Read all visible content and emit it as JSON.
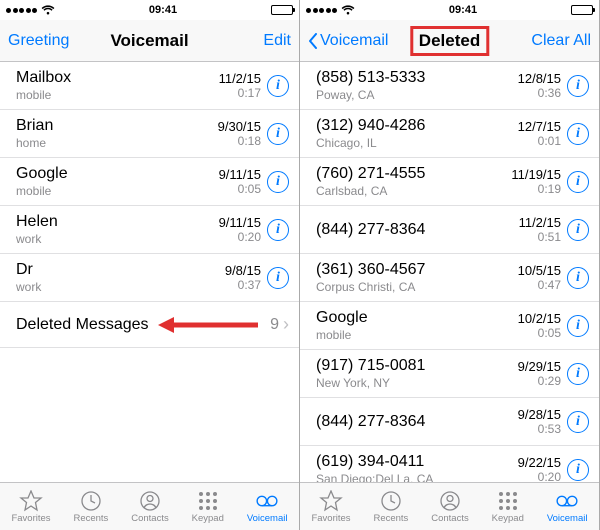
{
  "status": {
    "time": "09:41"
  },
  "left": {
    "nav": {
      "left": "Greeting",
      "title": "Voicemail",
      "right": "Edit"
    },
    "rows": [
      {
        "name": "Mailbox",
        "sub": "mobile",
        "date": "11/2/15",
        "time": "0:17"
      },
      {
        "name": "Brian",
        "sub": "home",
        "date": "9/30/15",
        "time": "0:18"
      },
      {
        "name": "Google",
        "sub": "mobile",
        "date": "9/11/15",
        "time": "0:05"
      },
      {
        "name": "Helen",
        "sub": "work",
        "date": "9/11/15",
        "time": "0:20"
      },
      {
        "name": "Dr",
        "sub": "work",
        "date": "9/8/15",
        "time": "0:37"
      }
    ],
    "deleted": {
      "label": "Deleted Messages",
      "count": "9"
    }
  },
  "right": {
    "nav": {
      "left": "Voicemail",
      "title": "Deleted",
      "right": "Clear All"
    },
    "rows": [
      {
        "name": "(858) 513-5333",
        "sub": "Poway, CA",
        "date": "12/8/15",
        "time": "0:36"
      },
      {
        "name": "(312) 940-4286",
        "sub": "Chicago, IL",
        "date": "12/7/15",
        "time": "0:01"
      },
      {
        "name": "(760) 271-4555",
        "sub": "Carlsbad, CA",
        "date": "11/19/15",
        "time": "0:19"
      },
      {
        "name": "(844) 277-8364",
        "sub": "",
        "date": "11/2/15",
        "time": "0:51"
      },
      {
        "name": "(361) 360-4567",
        "sub": "Corpus Christi, CA",
        "date": "10/5/15",
        "time": "0:47"
      },
      {
        "name": "Google",
        "sub": "mobile",
        "date": "10/2/15",
        "time": "0:05"
      },
      {
        "name": "(917) 715-0081",
        "sub": "New York, NY",
        "date": "9/29/15",
        "time": "0:29"
      },
      {
        "name": "(844) 277-8364",
        "sub": "",
        "date": "9/28/15",
        "time": "0:53"
      },
      {
        "name": "(619) 394-0411",
        "sub": "San Diego:Del La, CA",
        "date": "9/22/15",
        "time": "0:20"
      }
    ]
  },
  "tabs": {
    "favorites": "Favorites",
    "recents": "Recents",
    "contacts": "Contacts",
    "keypad": "Keypad",
    "voicemail": "Voicemail"
  },
  "glyphs": {
    "info": "i",
    "chevron": "›"
  }
}
